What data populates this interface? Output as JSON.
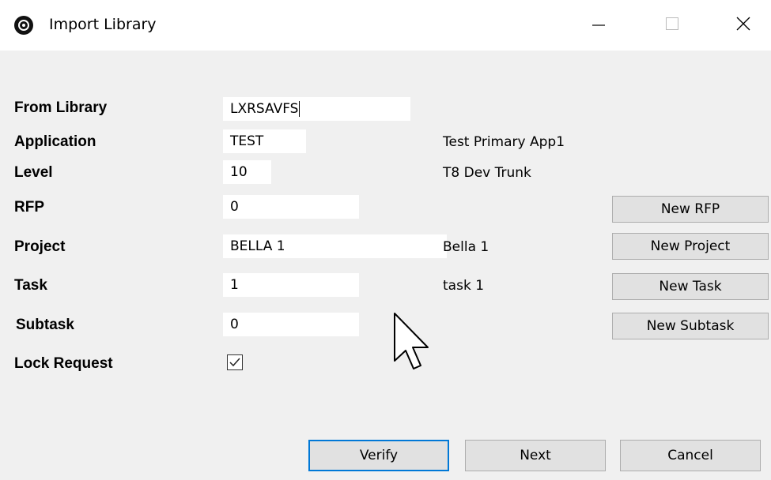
{
  "window": {
    "title": "Import Library",
    "icons": {
      "app": "app-disc-icon",
      "minimize": "minimize-icon",
      "maximize": "maximize-icon",
      "close": "close-icon"
    }
  },
  "form": {
    "from_library": {
      "label": "From Library",
      "value": "LXRSAVFS"
    },
    "application": {
      "label": "Application",
      "value": "TEST",
      "description": "Test Primary App1"
    },
    "level": {
      "label": "Level",
      "value": "10",
      "description": "T8 Dev Trunk"
    },
    "rfp": {
      "label": "RFP",
      "value": "0"
    },
    "project": {
      "label": "Project",
      "value": "BELLA 1",
      "description": "Bella 1"
    },
    "task": {
      "label": "Task",
      "value": "1",
      "description": "task 1"
    },
    "subtask": {
      "label": "Subtask",
      "value": "0"
    },
    "lock_request": {
      "label": "Lock Request",
      "checked": true
    }
  },
  "side_buttons": {
    "new_rfp": "New RFP",
    "new_project": "New Project",
    "new_task": "New Task",
    "new_subtask": "New Subtask"
  },
  "footer": {
    "verify": "Verify",
    "next": "Next",
    "cancel": "Cancel"
  },
  "cursor": "mouse-pointer-icon"
}
